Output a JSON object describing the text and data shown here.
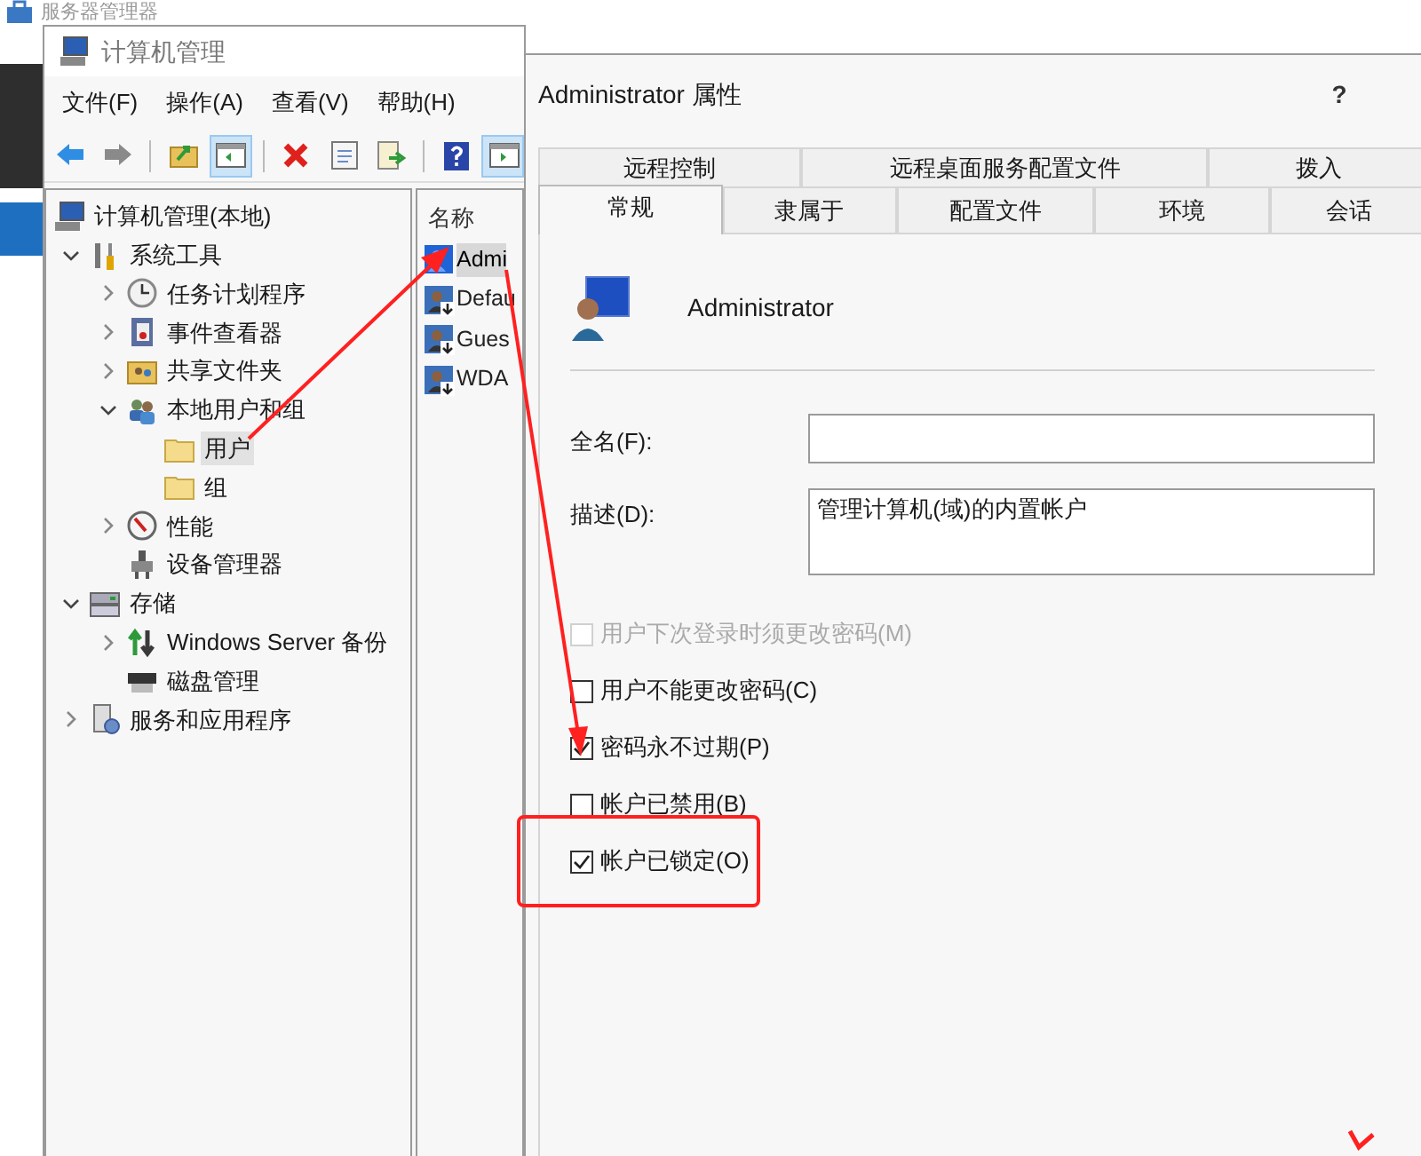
{
  "background_window": {
    "title": "服务器管理器"
  },
  "main_window": {
    "title": "计算机管理",
    "menu": [
      "文件(F)",
      "操作(A)",
      "查看(V)",
      "帮助(H)"
    ],
    "toolbar": [
      {
        "disabled": false,
        "pressed": false
      },
      {
        "disabled": true,
        "pressed": false
      },
      {
        "disabled": false,
        "pressed": false
      },
      {
        "disabled": false,
        "pressed": true
      },
      {
        "disabled": false,
        "pressed": false
      },
      {
        "disabled": false,
        "pressed": false
      },
      {
        "disabled": false,
        "pressed": false
      },
      {
        "disabled": false,
        "pressed": false
      },
      {
        "disabled": false,
        "pressed": true
      }
    ],
    "tree": [
      {
        "label": "计算机管理(本地)",
        "selected": false,
        "children": [
          {
            "label": "系统工具",
            "expanded": true,
            "selected": false,
            "children": [
              {
                "label": "任务计划程序",
                "expanded": false,
                "selected": false
              },
              {
                "label": "事件查看器",
                "expanded": false,
                "selected": false
              },
              {
                "label": "共享文件夹",
                "expanded": false,
                "selected": false
              },
              {
                "label": "本地用户和组",
                "expanded": true,
                "selected": false,
                "children": [
                  {
                    "label": "用户",
                    "selected": true
                  },
                  {
                    "label": "组",
                    "selected": false
                  }
                ]
              },
              {
                "label": "性能",
                "expanded": false,
                "selected": false
              },
              {
                "label": "设备管理器",
                "selected": false
              }
            ]
          },
          {
            "label": "存储",
            "expanded": true,
            "selected": false,
            "children": [
              {
                "label": "Windows Server 备份",
                "expanded": false,
                "selected": false
              },
              {
                "label": "磁盘管理",
                "selected": false
              }
            ]
          },
          {
            "label": "服务和应用程序",
            "expanded": false,
            "selected": false
          }
        ]
      }
    ],
    "list": {
      "column": "名称",
      "rows": [
        {
          "name": "Admi",
          "selected": true,
          "account_disabled": false
        },
        {
          "name": "Defau",
          "selected": false,
          "account_disabled": true
        },
        {
          "name": "Gues",
          "selected": false,
          "account_disabled": true
        },
        {
          "name": "WDA",
          "selected": false,
          "account_disabled": true
        }
      ]
    }
  },
  "dialog": {
    "title": "Administrator 属性",
    "help": "?",
    "tab_rows": [
      [
        {
          "label": "远程控制",
          "selected": false
        },
        {
          "label": "远程桌面服务配置文件",
          "selected": false
        },
        {
          "label": "拨入",
          "selected": false
        }
      ],
      [
        {
          "label": "常规",
          "selected": true
        },
        {
          "label": "隶属于",
          "selected": false
        },
        {
          "label": "配置文件",
          "selected": false
        },
        {
          "label": "环境",
          "selected": false
        },
        {
          "label": "会话",
          "selected": false
        }
      ]
    ],
    "user_name": "Administrator",
    "fields": [
      {
        "label": "全名(F):",
        "kind": "line"
      },
      {
        "label": "描述(D):",
        "value": "管理计算机(域)的内置帐户",
        "kind": "box"
      }
    ],
    "checkboxes": [
      {
        "label": "用户下次登录时须更改密码(M)",
        "checked": false,
        "disabled": true
      },
      {
        "label": "用户不能更改密码(C)",
        "checked": false,
        "disabled": false
      },
      {
        "label": "密码永不过期(P)",
        "checked": true,
        "disabled": false
      },
      {
        "label": "帐户已禁用(B)",
        "checked": false,
        "disabled": false
      },
      {
        "label": "帐户已锁定(O)",
        "checked": true,
        "disabled": false
      }
    ]
  }
}
